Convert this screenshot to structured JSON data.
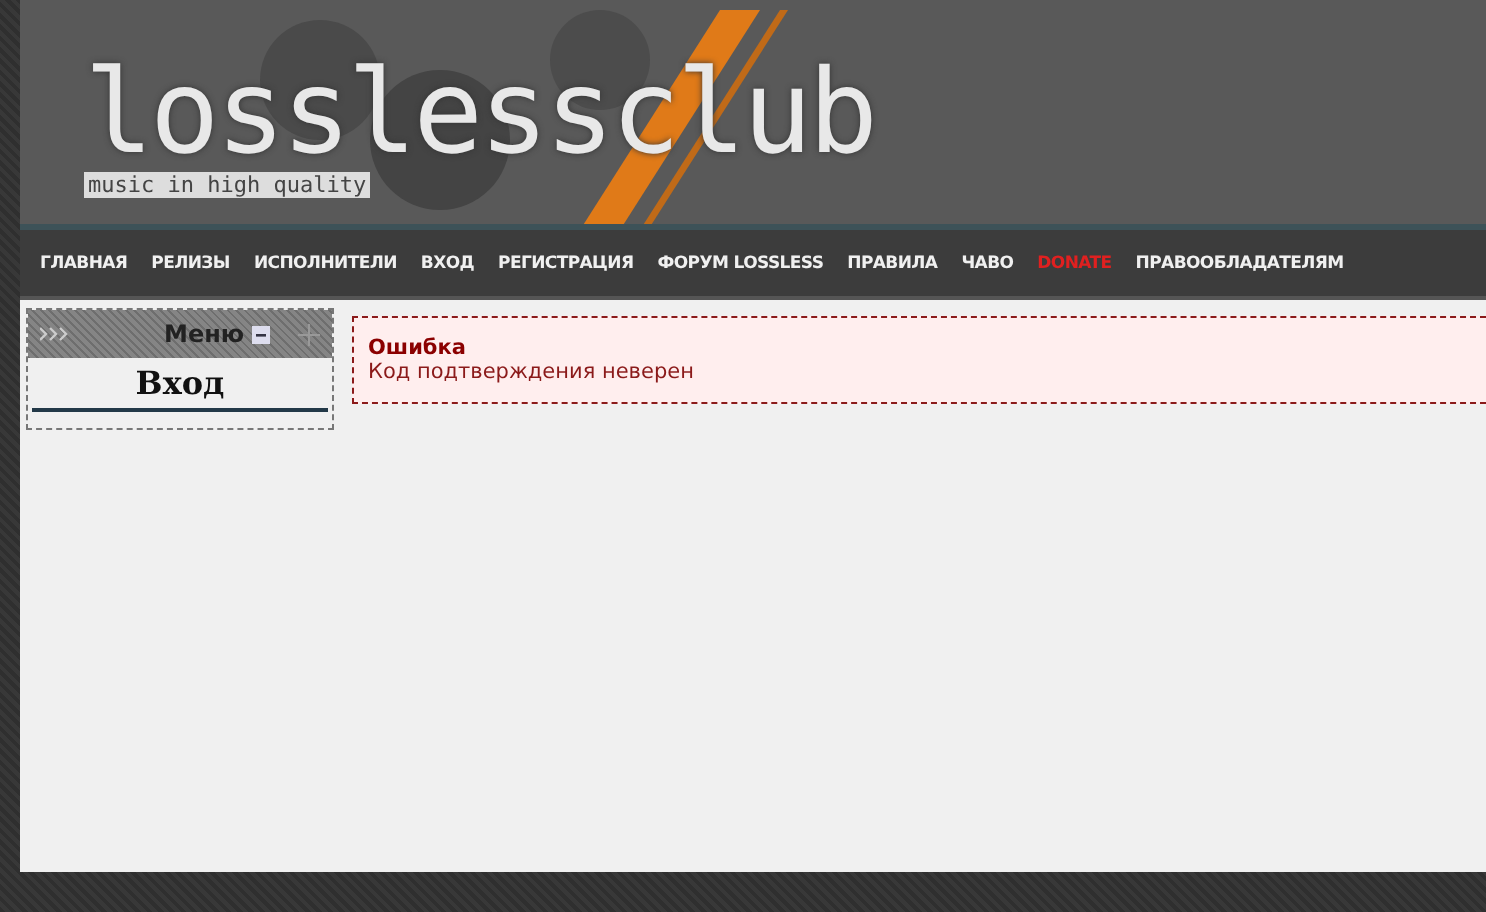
{
  "logo": {
    "name": "losslessclub",
    "tagline": "music in high quality"
  },
  "nav": [
    {
      "label": "ГЛАВНАЯ",
      "kind": "link"
    },
    {
      "label": "РЕЛИЗЫ",
      "kind": "link"
    },
    {
      "label": "ИСПОЛНИТЕЛИ",
      "kind": "link"
    },
    {
      "label": "ВХОД",
      "kind": "link"
    },
    {
      "label": "РЕГИСТРАЦИЯ",
      "kind": "link"
    },
    {
      "label": "ФОРУМ LOSSLESS",
      "kind": "link"
    },
    {
      "label": "ПРАВИЛА",
      "kind": "link"
    },
    {
      "label": "ЧАВО",
      "kind": "link"
    },
    {
      "label": "DONATE",
      "kind": "highlight"
    },
    {
      "label": "ПРАВООБЛАДАТЕЛЯМ",
      "kind": "link"
    }
  ],
  "menu_block": {
    "title": "Меню",
    "expanded": true,
    "items": [
      "Вход"
    ]
  },
  "error": {
    "title": "Ошибка",
    "message": "Код подтверждения неверен"
  }
}
